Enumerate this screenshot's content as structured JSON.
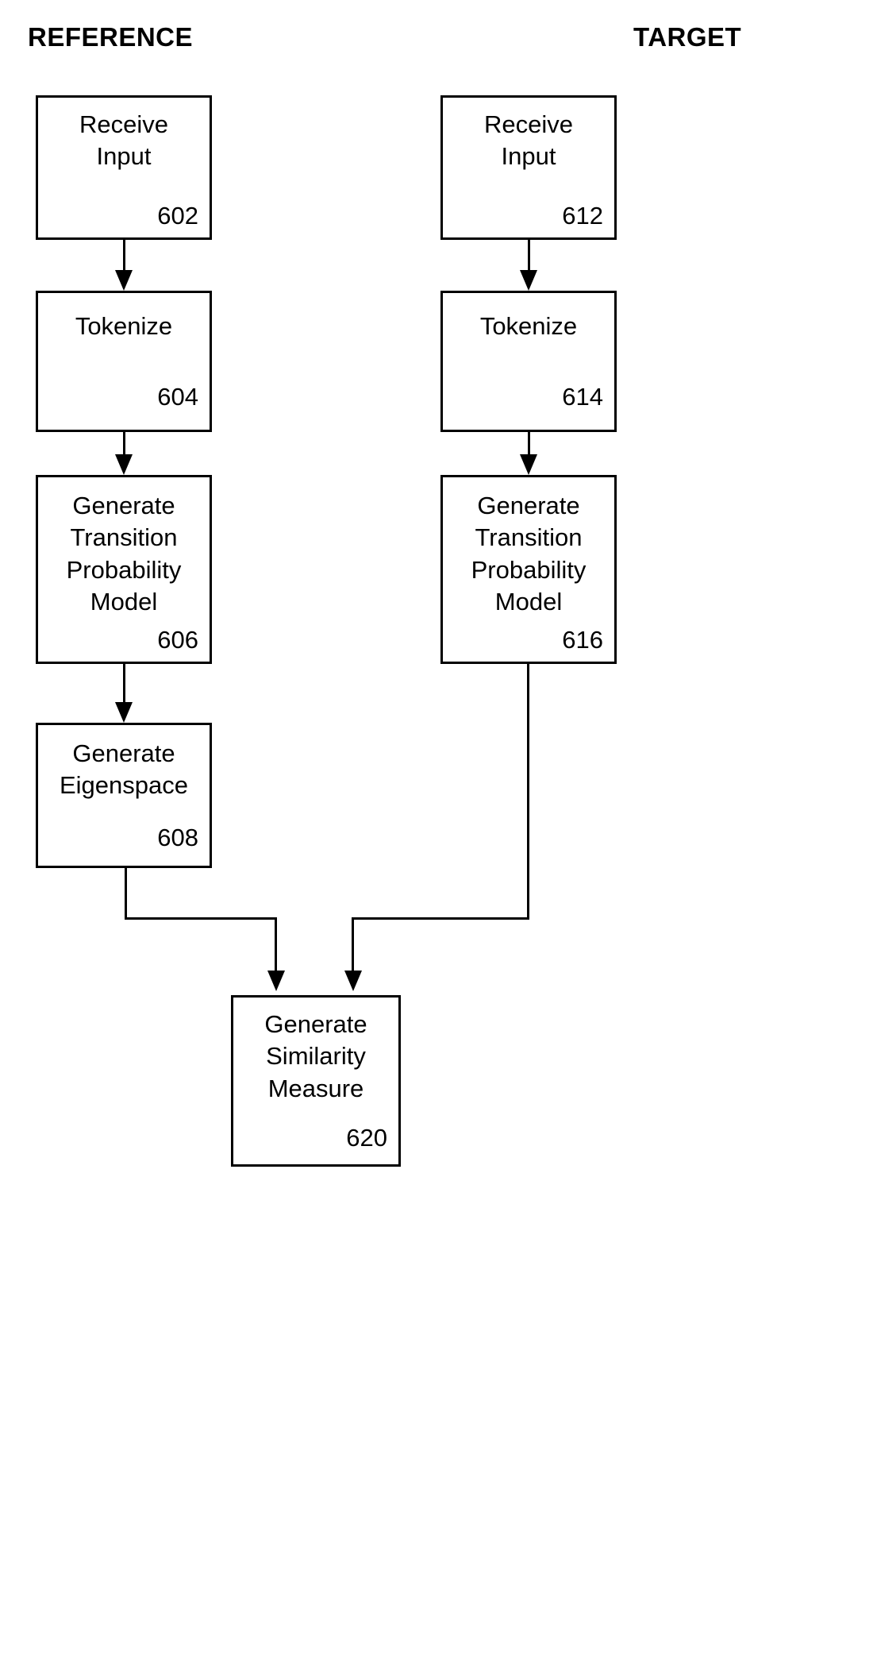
{
  "figure": {
    "type": "flowchart",
    "columns": [
      {
        "id": "reference",
        "header": "REFERENCE"
      },
      {
        "id": "target",
        "header": "TARGET"
      }
    ]
  },
  "headers": {
    "reference": "REFERENCE",
    "target": "TARGET"
  },
  "nodes": {
    "n602": {
      "label": "Receive\nInput",
      "ref": "602"
    },
    "n604": {
      "label": "Tokenize",
      "ref": "604"
    },
    "n606": {
      "label": "Generate\nTransition\nProbability\nModel",
      "ref": "606"
    },
    "n608": {
      "label": "Generate\nEigenspace",
      "ref": "608"
    },
    "n612": {
      "label": "Receive\nInput",
      "ref": "612"
    },
    "n614": {
      "label": "Tokenize",
      "ref": "614"
    },
    "n616": {
      "label": "Generate\nTransition\nProbability\nModel",
      "ref": "616"
    },
    "n620": {
      "label": "Generate\nSimilarity\nMeasure",
      "ref": "620"
    }
  },
  "edges": [
    {
      "from": "n602",
      "to": "n604",
      "style": "straight-down-arrow"
    },
    {
      "from": "n604",
      "to": "n606",
      "style": "straight-down-arrow"
    },
    {
      "from": "n606",
      "to": "n608",
      "style": "straight-down-arrow"
    },
    {
      "from": "n612",
      "to": "n614",
      "style": "straight-down-arrow"
    },
    {
      "from": "n614",
      "to": "n616",
      "style": "straight-down-arrow"
    },
    {
      "from": "n608",
      "to": "n620",
      "style": "elbow-down-right-down-arrow"
    },
    {
      "from": "n616",
      "to": "n620",
      "style": "elbow-down-left-down-arrow"
    }
  ],
  "colors": {
    "background": "#ffffff",
    "stroke": "#000000",
    "text": "#000000"
  }
}
